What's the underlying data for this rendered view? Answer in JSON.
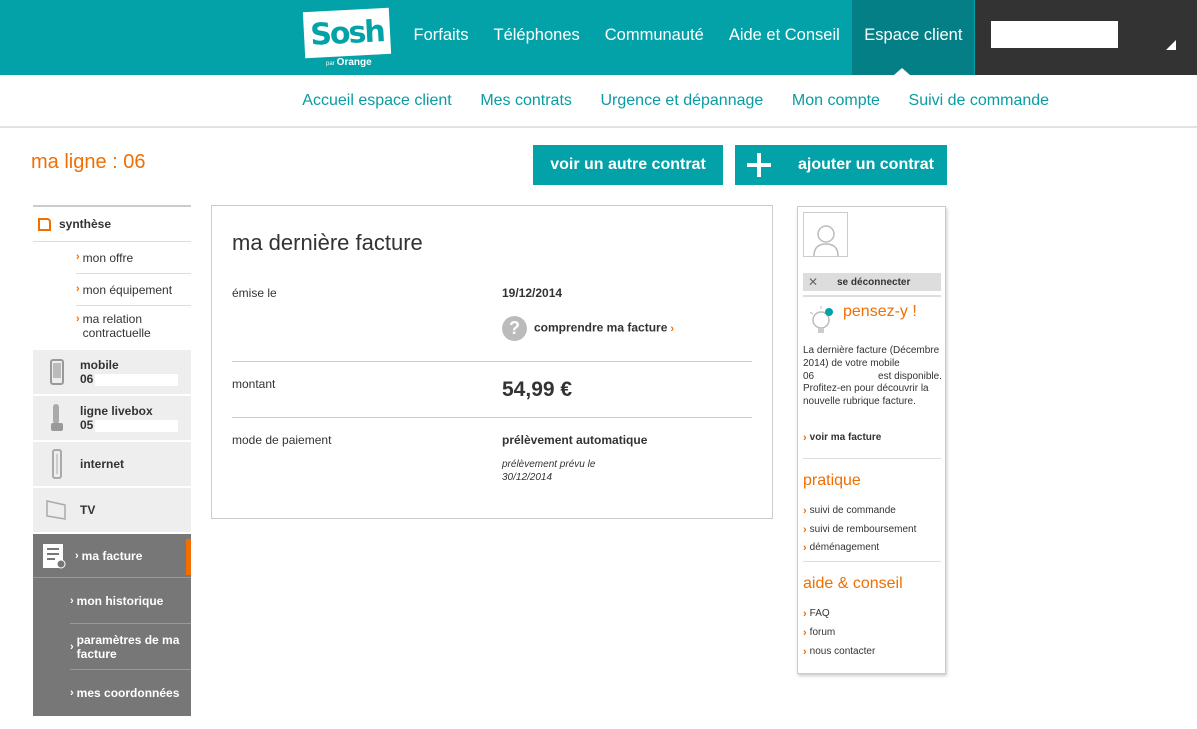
{
  "header": {
    "logo": "Sosh",
    "logo_sub_small": "par",
    "logo_sub": "Orange",
    "nav": [
      "Forfaits",
      "Téléphones",
      "Communauté",
      "Aide et Conseil",
      "Espace client"
    ],
    "active_nav": "Espace client"
  },
  "subnav": [
    "Accueil espace client",
    "Mes contrats",
    "Urgence et dépannage",
    "Mon compte",
    "Suivi de commande"
  ],
  "page": {
    "title": "ma ligne : 06",
    "btn_other": "voir un autre contrat",
    "btn_add": "ajouter un contrat"
  },
  "sidebar": {
    "synthese": "synthèse",
    "synthese_items": [
      "mon offre",
      "mon équipement",
      "ma relation contractuelle"
    ],
    "mobile": {
      "label": "mobile",
      "number": "06"
    },
    "livebox": {
      "label": "ligne livebox",
      "number": "05"
    },
    "internet": "internet",
    "tv": "TV",
    "facture": "ma facture",
    "facture_items": [
      "mon historique",
      "paramètres de ma facture",
      "mes coordonnées"
    ]
  },
  "bill": {
    "title": "ma dernière facture",
    "emise_label": "émise le",
    "emise_value": "19/12/2014",
    "help_link": "comprendre ma facture",
    "amount_label": "montant",
    "amount_value": "54,99 €",
    "payment_label": "mode de paiement",
    "payment_value": "prélèvement automatique",
    "payment_note": "prélèvement prévu le 30/12/2014"
  },
  "right": {
    "logout": "se déconnecter",
    "pensez": "pensez-y !",
    "pensez_badge": "!",
    "text_1": "La dernière facture (Décembre 2014) de votre mobile 06",
    "text_2": "est disponible. Profitez-en pour découvrir la nouvelle rubrique facture.",
    "see_bill": "voir ma facture",
    "pratique": "pratique",
    "pratique_links": [
      "suivi de commande",
      "suivi de remboursement",
      "déménagement"
    ],
    "aide": "aide & conseil",
    "aide_links": [
      "FAQ",
      "forum",
      "nous contacter"
    ]
  },
  "colors": {
    "teal": "#03A2A9",
    "teal_dark": "#057F86",
    "orange": "#F16E00",
    "dark": "#333333"
  }
}
